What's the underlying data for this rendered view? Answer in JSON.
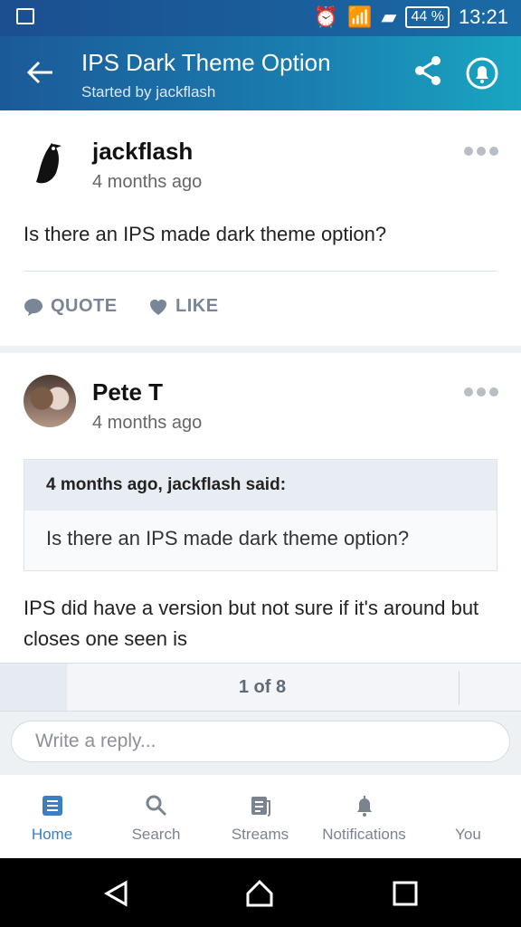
{
  "status": {
    "battery": "44 %",
    "time": "13:21"
  },
  "header": {
    "title": "IPS Dark Theme Option",
    "subtitle": "Started by jackflash"
  },
  "posts": [
    {
      "author": "jackflash",
      "time": "4 months ago",
      "content": "Is there an IPS made dark theme option?",
      "quote_label": "QUOTE",
      "like_label": "LIKE"
    },
    {
      "author": "Pete T",
      "time": "4 months ago",
      "quote_header": "4 months ago, jackflash said:",
      "quote_text": "Is there an IPS made dark theme option?",
      "content": "IPS did have a version but not sure if it's around but closes one seen is"
    }
  ],
  "pagination": {
    "label": "1 of 8"
  },
  "reply": {
    "placeholder": "Write a reply..."
  },
  "tabs": [
    {
      "label": "Home",
      "icon": "home-icon"
    },
    {
      "label": "Search",
      "icon": "search-icon"
    },
    {
      "label": "Streams",
      "icon": "streams-icon"
    },
    {
      "label": "Notifications",
      "icon": "notifications-icon"
    },
    {
      "label": "You",
      "icon": "profile-icon"
    }
  ],
  "colors": {
    "accent": "#3d7fbe",
    "header_start": "#1b5a98",
    "header_end": "#19a6c2"
  }
}
